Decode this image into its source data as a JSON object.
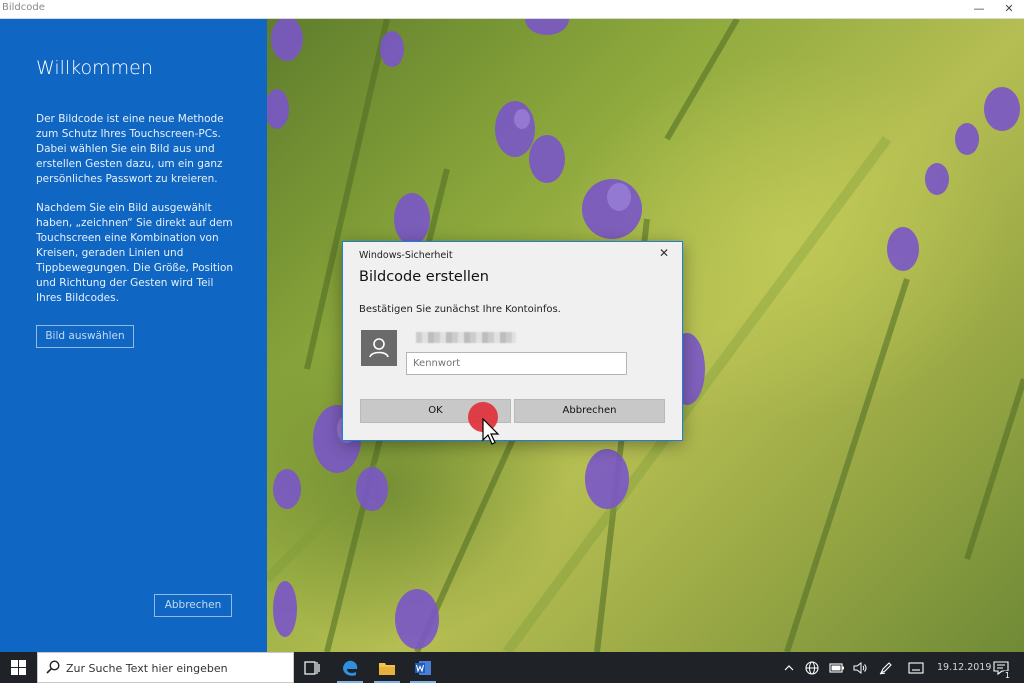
{
  "window": {
    "title": "Bildcode",
    "minimize_glyph": "—",
    "close_glyph": "✕"
  },
  "left_panel": {
    "heading": "Willkommen",
    "paragraph1": "Der Bildcode ist eine neue Methode zum Schutz Ihres Touchscreen-PCs. Dabei wählen Sie ein Bild aus und erstellen Gesten dazu, um ein ganz persönliches Passwort zu kreieren.",
    "paragraph2": "Nachdem Sie ein Bild ausgewählt haben, „zeichnen“ Sie direkt auf dem Touchscreen eine Kombination von Kreisen, geraden Linien und Tippbewegungen. Die Größe, Position und Richtung der Gesten wird Teil Ihres Bildcodes.",
    "select_button": "Bild auswählen",
    "cancel_button": "Abbrechen"
  },
  "dialog": {
    "title": "Windows-Sicherheit",
    "close_glyph": "✕",
    "heading": "Bildcode erstellen",
    "message": "Bestätigen Sie zunächst Ihre Kontoinfos.",
    "password_placeholder": "Kennwort",
    "ok_button": "OK",
    "cancel_button": "Abbrechen"
  },
  "taskbar": {
    "search_placeholder": "Zur Suche Text hier eingeben",
    "date": "19.12.2019",
    "notification_count": "1"
  },
  "colors": {
    "accent_blue": "#0f66c3",
    "taskbar": "#1f2226",
    "cursor_marker": "#e0313b"
  },
  "icons": [
    "windows-start-icon",
    "search-icon",
    "task-view-icon",
    "edge-icon",
    "file-explorer-icon",
    "word-icon",
    "chevron-up-icon",
    "globe-icon",
    "battery-icon",
    "volume-icon",
    "pen-icon",
    "keyboard-icon",
    "notification-icon",
    "user-icon"
  ]
}
